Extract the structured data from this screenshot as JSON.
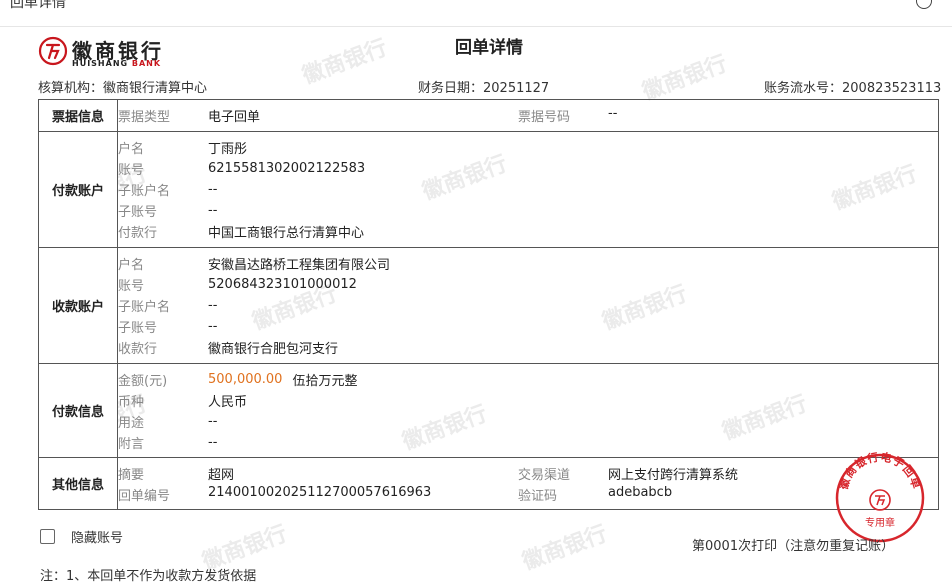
{
  "window": {
    "title": "回单详情"
  },
  "bank": {
    "name_cn": "徽商银行",
    "name_en_prefix": "HUISHANG",
    "name_en_suffix": "BANK",
    "brand_color": "#c8161d"
  },
  "header": {
    "title": "回单详情",
    "agency_label": "核算机构：",
    "agency_value": "徽商银行清算中心",
    "date_label": "财务日期：",
    "date_value": "20251127",
    "serial_label": "账务流水号：",
    "serial_value": "200823523113"
  },
  "watermark_text": "徽商银行",
  "sections": {
    "bill": {
      "title": "票据信息",
      "type_label": "票据类型",
      "type_value": "电子回单",
      "no_label": "票据号码",
      "no_value": "--"
    },
    "payer": {
      "title": "付款账户",
      "rows": [
        {
          "label": "户名",
          "value": "丁雨彤"
        },
        {
          "label": "账号",
          "value": "6215581302002122583"
        },
        {
          "label": "子账户名",
          "value": "--"
        },
        {
          "label": "子账号",
          "value": "--"
        },
        {
          "label": "付款行",
          "value": "中国工商银行总行清算中心"
        }
      ]
    },
    "payee": {
      "title": "收款账户",
      "rows": [
        {
          "label": "户名",
          "value": "安徽昌达路桥工程集团有限公司"
        },
        {
          "label": "账号",
          "value": "520684323101000012"
        },
        {
          "label": "子账户名",
          "value": "--"
        },
        {
          "label": "子账号",
          "value": "--"
        },
        {
          "label": "收款行",
          "value": "徽商银行合肥包河支行"
        }
      ]
    },
    "payment": {
      "title": "付款信息",
      "amount_label": "金额(元)",
      "amount_value": "500,000.00",
      "amount_caps": "伍拾万元整",
      "currency_label": "币种",
      "currency_value": "人民币",
      "purpose_label": "用途",
      "purpose_value": "--",
      "remark_label": "附言",
      "remark_value": "--"
    },
    "other": {
      "title": "其他信息",
      "summary_label": "摘要",
      "summary_value": "超网",
      "receipt_no_label": "回单编号",
      "receipt_no_value": "21400100202511270005761696​3",
      "channel_label": "交易渠道",
      "channel_value": "网上支付跨行清算系统",
      "verify_label": "验证码",
      "verify_value": "adebabcb"
    }
  },
  "stamp": {
    "text": "徽商银行电子回单",
    "sub": "专用章",
    "color": "#d7262c"
  },
  "footer": {
    "hide_account_label": "隐藏账号",
    "print_note": "第0001次打印（注意勿重复记账）",
    "footnote": "注：1、本回单不作为收款方发货依据"
  }
}
